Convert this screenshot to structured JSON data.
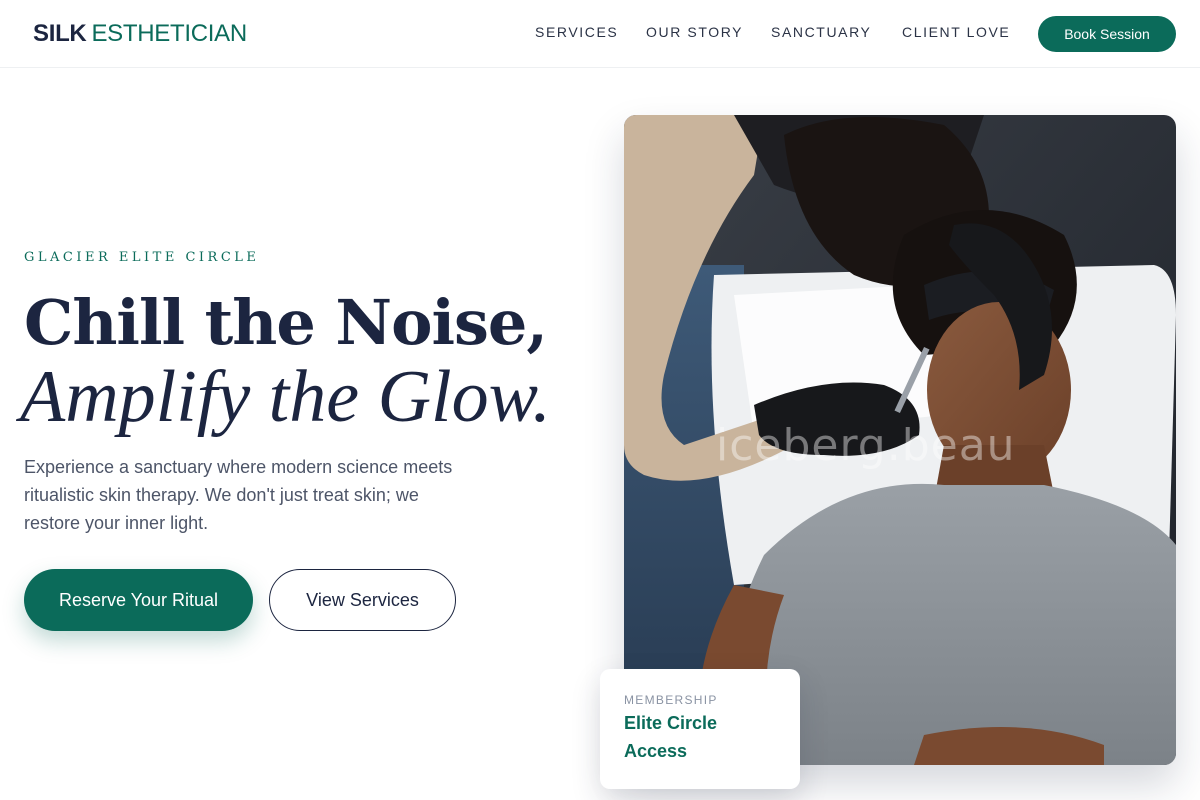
{
  "header": {
    "brand_primary": "SILK",
    "brand_secondary": "ESTHETICIAN",
    "nav": [
      "SERVICES",
      "OUR STORY",
      "SANCTUARY",
      "CLIENT LOVE"
    ],
    "cta_label": "Book Session"
  },
  "hero": {
    "eyebrow": "GLACIER ELITE CIRCLE",
    "headline_line1": "Chill the Noise,",
    "headline_line2": "Amplify the Glow.",
    "description": "Experience a sanctuary where modern science meets ritualistic skin therapy. We don't just treat skin; we restore your inner light.",
    "primary_button": "Reserve Your Ritual",
    "secondary_button": "View Services"
  },
  "image": {
    "watermark": "iceberg.beau"
  },
  "card": {
    "label": "MEMBERSHIP",
    "title": "Elite Circle Access"
  },
  "colors": {
    "accent": "#0b6b5a",
    "navy": "#1c2540",
    "body_text": "#4d5568"
  }
}
